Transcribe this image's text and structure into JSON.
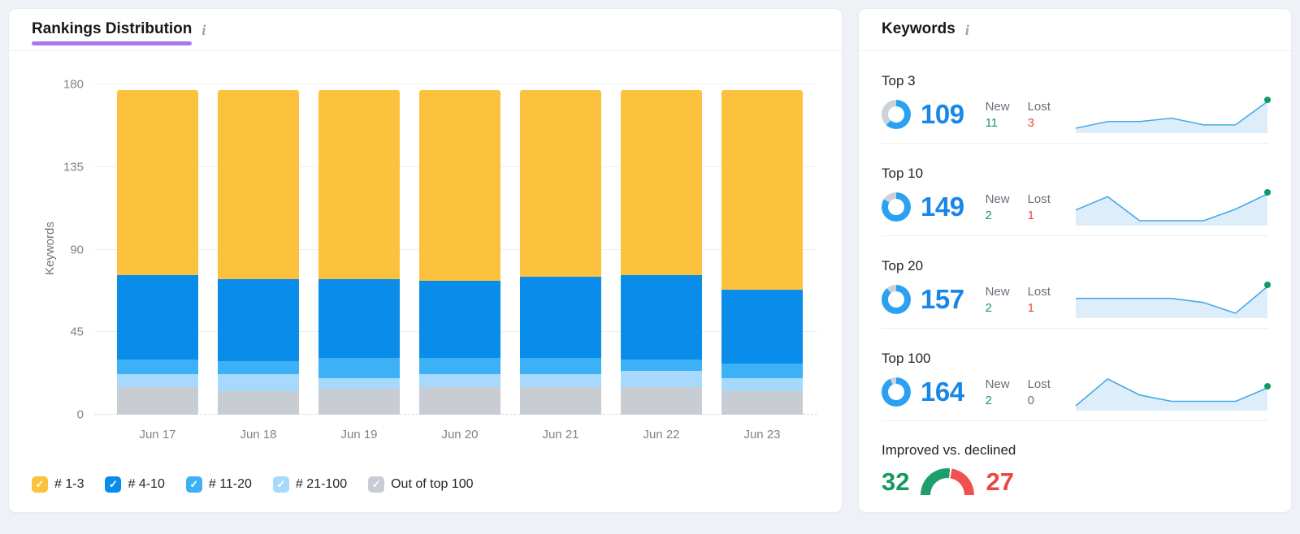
{
  "page": {
    "background": "#eef1f5"
  },
  "rankings_card": {
    "title": "Rankings Distribution",
    "info_icon": "i",
    "accent_underline_color": "#a878f0",
    "chart_data": {
      "type": "bar",
      "stacked": true,
      "title": "Rankings Distribution",
      "ylabel": "Keywords",
      "ylim": [
        0,
        180
      ],
      "yticks": [
        0,
        45,
        90,
        135,
        180
      ],
      "categories": [
        "Jun 17",
        "Jun 18",
        "Jun 19",
        "Jun 20",
        "Jun 21",
        "Jun 22",
        "Jun 23"
      ],
      "series": [
        {
          "name": "# 1-3",
          "color": "#fcc13d",
          "values": [
            101,
            103,
            103,
            104,
            102,
            101,
            109
          ]
        },
        {
          "name": "# 4-10",
          "color": "#0a8ceb",
          "values": [
            46,
            45,
            43,
            42,
            44,
            46,
            40
          ]
        },
        {
          "name": "# 11-20",
          "color": "#3cb1f5",
          "values": [
            8,
            7,
            11,
            9,
            9,
            6,
            8
          ]
        },
        {
          "name": "# 21-100",
          "color": "#a6d9fb",
          "values": [
            7,
            9,
            6,
            7,
            7,
            9,
            7
          ]
        },
        {
          "name": "Out of top 100",
          "color": "#c8cdd4",
          "values": [
            15,
            13,
            14,
            15,
            15,
            15,
            13
          ]
        }
      ],
      "legend_position": "bottom",
      "grid": true
    }
  },
  "keywords_card": {
    "title": "Keywords",
    "info_icon": "i",
    "rows": [
      {
        "label": "Top 3",
        "value": "109",
        "percent": 62,
        "new_label": "New",
        "new": "11",
        "lost_label": "Lost",
        "lost": "3",
        "spark": [
          101,
          103,
          103,
          104,
          102,
          102,
          109
        ]
      },
      {
        "label": "Top 10",
        "value": "149",
        "percent": 84,
        "new_label": "New",
        "new": "2",
        "lost_label": "Lost",
        "lost": "1",
        "spark": [
          147.2,
          148.7,
          146,
          146,
          146,
          147.3,
          149
        ]
      },
      {
        "label": "Top 20",
        "value": "157",
        "percent": 89,
        "new_label": "New",
        "new": "2",
        "lost_label": "Lost",
        "lost": "1",
        "spark": [
          155,
          155,
          155,
          155,
          154.3,
          152.5,
          157
        ]
      },
      {
        "label": "Top 100",
        "value": "164",
        "percent": 93,
        "new_label": "New",
        "new": "2",
        "lost_label": "Lost",
        "lost": "0",
        "spark": [
          162,
          165,
          163.2,
          162.5,
          162.5,
          162.5,
          164
        ]
      }
    ],
    "improved_vs_declined": {
      "label": "Improved vs. declined",
      "improved": "32",
      "declined": "27"
    }
  },
  "colors": {
    "metric_number": "#1a86e8",
    "donut_ring": "#2aa1f1",
    "donut_track": "#ccd2d9",
    "spark_line": "#47a9e9",
    "spark_fill": "#ddeefa",
    "spark_dot": "#0e9a60",
    "positive": "#149a5f",
    "negative": "#e8483f",
    "neutral": "#69707a",
    "gauge_green": "#1d9f6d",
    "gauge_red": "#f15050"
  }
}
